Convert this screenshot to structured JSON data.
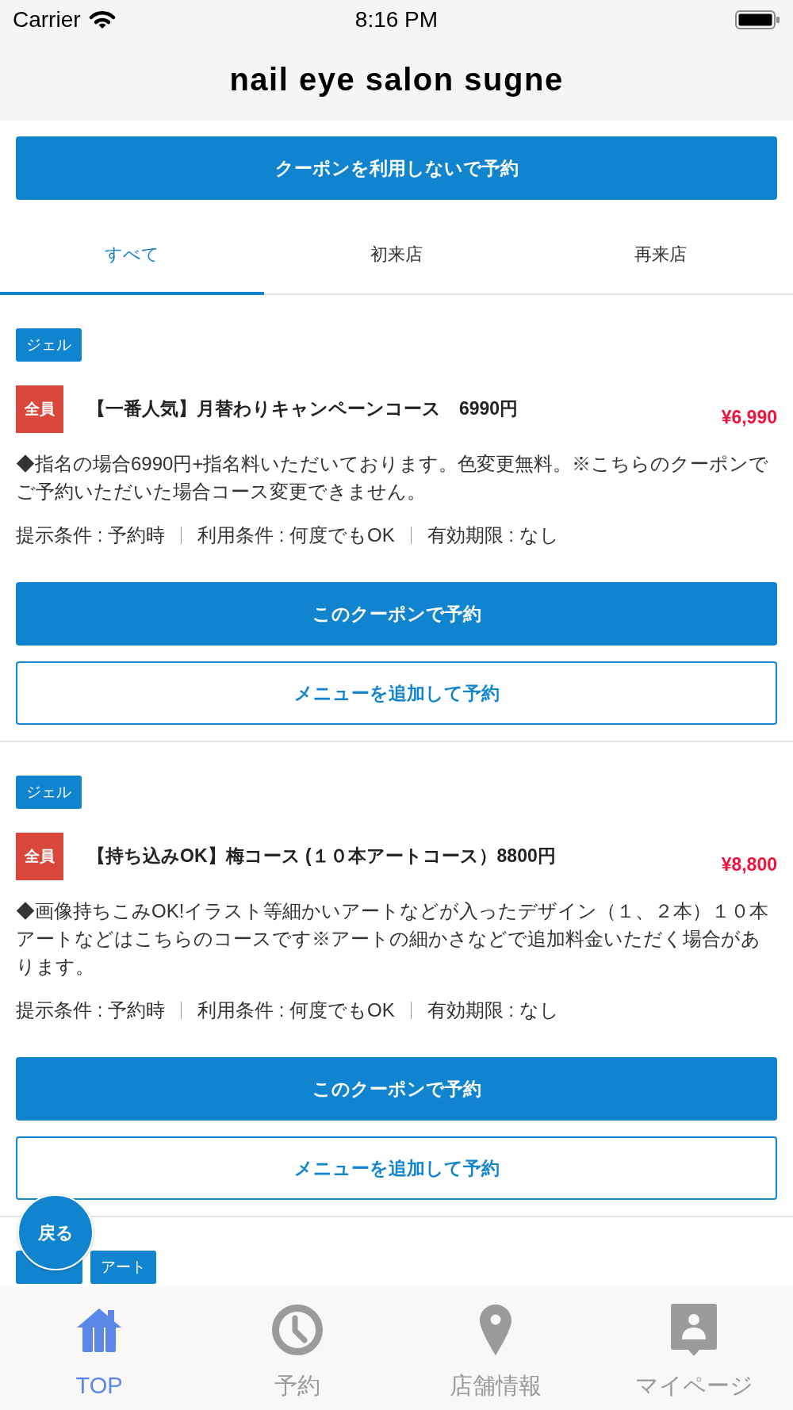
{
  "status_bar": {
    "carrier": "Carrier",
    "time": "8:16 PM"
  },
  "header": {
    "title": "nail eye salon sugne"
  },
  "reserve_without_coupon_button": {
    "label": "クーポンを利用しないで予約"
  },
  "tabs": [
    {
      "label": "すべて",
      "selected": true
    },
    {
      "label": "初来店",
      "selected": false
    },
    {
      "label": "再来店",
      "selected": false
    }
  ],
  "coupons": [
    {
      "tags": [
        {
          "kind": "text",
          "label": "ジェル"
        }
      ],
      "target": "全員",
      "title": "【一番人気】月替わりキャンペーンコース　6990円",
      "price": "¥6,990",
      "description": "◆指名の場合6990円+指名料いただいております。色変更無料。※こちらのクーポンでご予約いただいた場合コース変更できません。",
      "conditions": [
        "提示条件 : 予約時",
        "利用条件 : 何度でもOK",
        "有効期限 : なし"
      ],
      "buttons": [
        {
          "kind": "primary",
          "label": "このクーポンで予約"
        },
        {
          "kind": "outline",
          "label": "メニューを追加して予約"
        }
      ]
    },
    {
      "tags": [
        {
          "kind": "text",
          "label": "ジェル"
        }
      ],
      "target": "全員",
      "title": "【持ち込みOK】梅コース (１０本アートコース）8800円",
      "price": "¥8,800",
      "description": "◆画像持ちこみOK!イラスト等細かいアートなどが入ったデザイン（１、２本）１０本アートなどはこちらのコースです※アートの細かさなどで追加料金いただく場合があります。",
      "conditions": [
        "提示条件 : 予約時",
        "利用条件 : 何度でもOK",
        "有効期限 : なし"
      ],
      "buttons": [
        {
          "kind": "primary",
          "label": "このクーポンで予約"
        },
        {
          "kind": "outline",
          "label": "メニューを追加して予約"
        }
      ]
    },
    {
      "tags": [
        {
          "kind": "covered"
        },
        {
          "kind": "text",
          "label": "アート"
        }
      ]
    }
  ],
  "back_button": {
    "label": "戻る"
  },
  "tab_bar": [
    {
      "label": "TOP",
      "selected": true
    },
    {
      "label": "予約",
      "selected": false
    },
    {
      "label": "店舗情報",
      "selected": false
    },
    {
      "label": "マイページ",
      "selected": false
    }
  ]
}
